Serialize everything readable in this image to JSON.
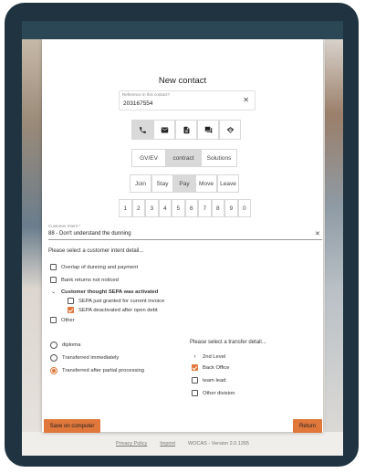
{
  "modal": {
    "title": "New contact",
    "reference": {
      "label": "Reference in this contact?",
      "value": "203167554"
    },
    "channel_icons": [
      "phone-icon",
      "mail-icon",
      "document-icon",
      "chat-icon",
      "signature-icon"
    ],
    "channel_active_index": 0,
    "type_tabs": [
      "GV/EV",
      "contract",
      "Solutions"
    ],
    "type_active_index": 1,
    "phase_tabs": [
      "Join",
      "Stay",
      "Pay",
      "Move",
      "Leave"
    ],
    "phase_active_index": 2,
    "numbers": [
      "1",
      "2",
      "3",
      "4",
      "5",
      "6",
      "7",
      "8",
      "9",
      "0"
    ],
    "intent": {
      "label": "Customer Intent *",
      "value": "88 - Don't understand the dunning"
    },
    "intent_prompt": "Please select a customer intent detail...",
    "intent_details": {
      "overlap": "Overlap of dunning and payment",
      "bank": "Bank returns not noticed",
      "sepa_header": "Customer thought SEPA was activated",
      "sepa_granted": "SEPA just granted for current invoice",
      "sepa_deactivated": "SEPA deactivated after open debt",
      "other": "Other"
    },
    "resolution": {
      "diploma": "diploma",
      "immediately": "Transferred immediately",
      "partial": "Transferred after partial processing"
    },
    "transfer_prompt": "Please select a transfer detail...",
    "transfer_details": {
      "second_level": "2nd Level",
      "back_office": "Back Office",
      "team_lead": "team lead",
      "other_division": "Other division"
    },
    "save_label": "Save on computer",
    "return_label": "Return"
  },
  "footer": {
    "privacy": "Privacy Policy",
    "imprint": "Imprint",
    "version": "WOCAS - Version 2.0.1265"
  },
  "colors": {
    "accent": "#e0773b",
    "frame": "#1f3440",
    "topbar": "#2b4755"
  }
}
